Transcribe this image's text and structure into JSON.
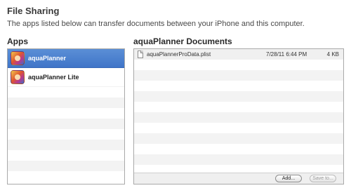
{
  "header": {
    "title": "File Sharing",
    "description": "The apps listed below can transfer documents between your iPhone and this computer."
  },
  "apps": {
    "heading": "Apps",
    "items": [
      {
        "name": "aquaPlanner",
        "selected": true
      },
      {
        "name": "aquaPlanner Lite",
        "selected": false
      }
    ]
  },
  "documents": {
    "heading": "aquaPlanner Documents",
    "files": [
      {
        "name": "aquaPlannerProData.plist",
        "date": "7/28/11 6:44 PM",
        "size": "4 KB"
      }
    ],
    "buttons": {
      "add": "Add...",
      "save_to": "Save to..."
    }
  },
  "colors": {
    "selection": "#4a80cf",
    "stripe": "#f3f3f3",
    "border": "#a9a9a9"
  }
}
